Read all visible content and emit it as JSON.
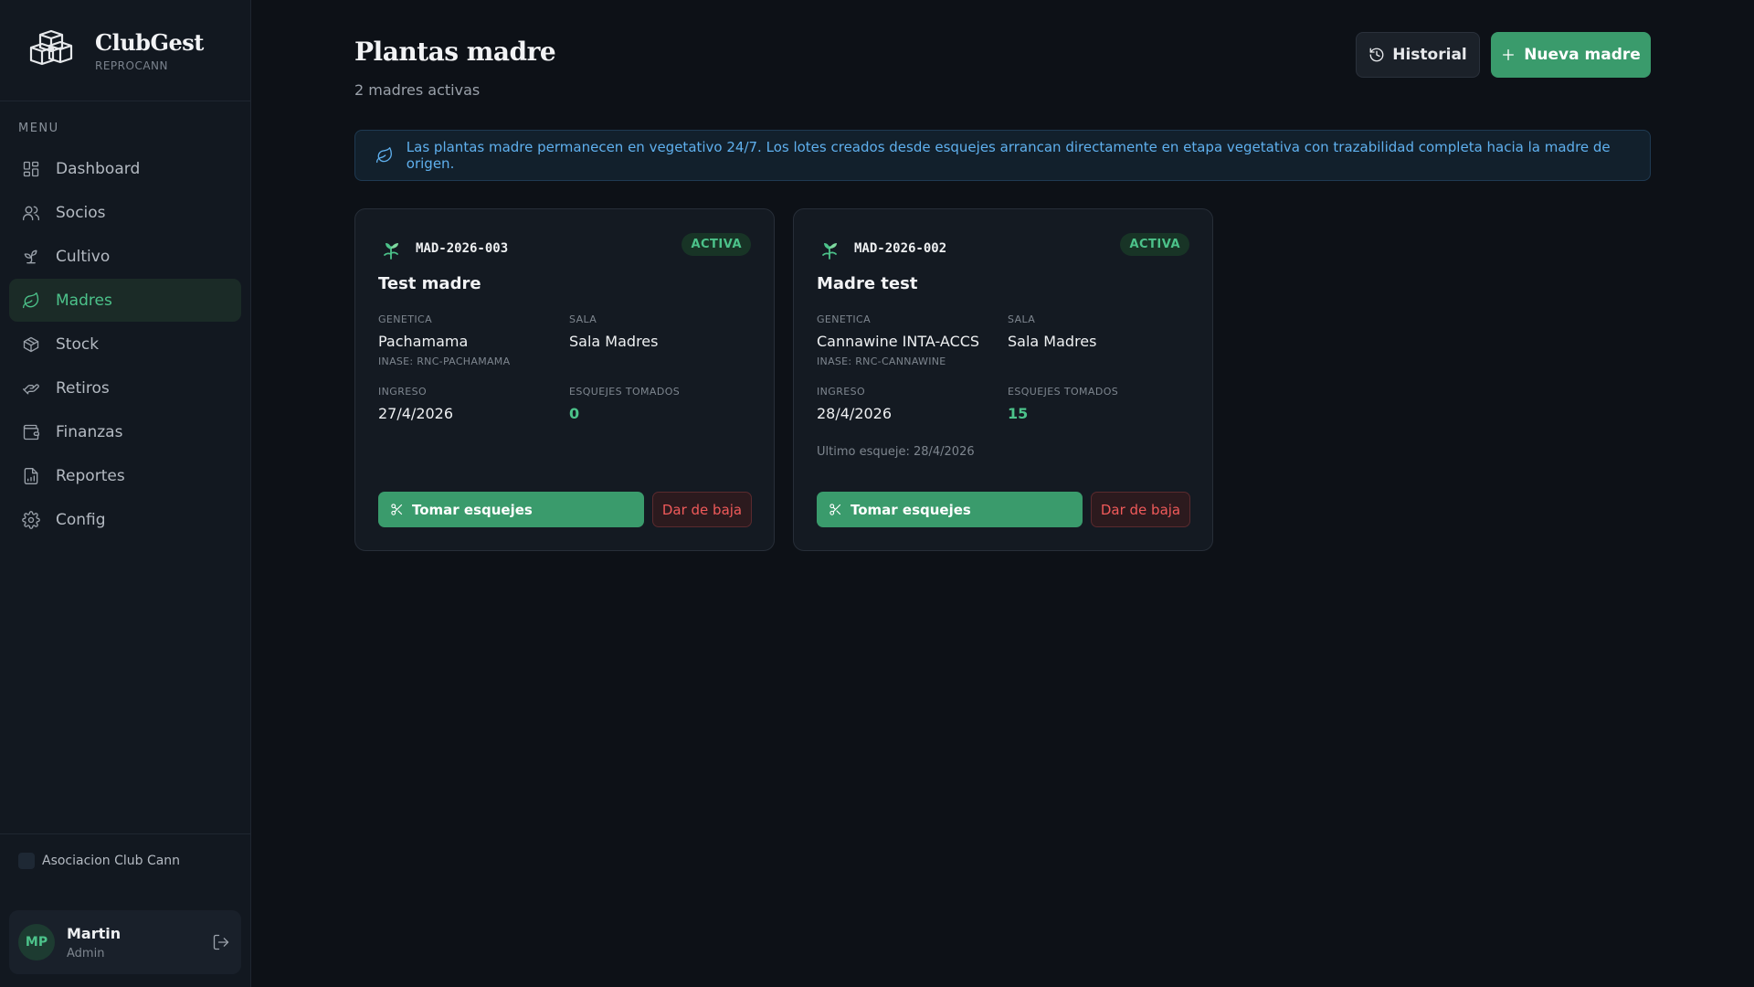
{
  "app": {
    "name": "ClubGest",
    "subtitle": "REPROCANN"
  },
  "sidebar": {
    "menu_label": "MENU",
    "items": [
      {
        "label": "Dashboard",
        "icon": "grid-icon",
        "active": false
      },
      {
        "label": "Socios",
        "icon": "users-icon",
        "active": false
      },
      {
        "label": "Cultivo",
        "icon": "sprout-icon",
        "active": false
      },
      {
        "label": "Madres",
        "icon": "leaf-icon",
        "active": true
      },
      {
        "label": "Stock",
        "icon": "package-icon",
        "active": false
      },
      {
        "label": "Retiros",
        "icon": "hand-icon",
        "active": false
      },
      {
        "label": "Finanzas",
        "icon": "wallet-icon",
        "active": false
      },
      {
        "label": "Reportes",
        "icon": "report-icon",
        "active": false
      },
      {
        "label": "Config",
        "icon": "gear-icon",
        "active": false
      }
    ],
    "organization": "Asociacion Club Cann",
    "user": {
      "initials": "MP",
      "name": "Martin",
      "role": "Admin"
    }
  },
  "header": {
    "title": "Plantas madre",
    "subtitle": "2 madres activas",
    "history_label": "Historial",
    "new_label": "Nueva madre"
  },
  "info_banner": "Las plantas madre permanecen en vegetativo 24/7. Los lotes creados desde esquejes arrancan directamente en etapa vegetativa con trazabilidad completa hacia la madre de origen.",
  "labels": {
    "genetics": "GENETICA",
    "room": "SALA",
    "entry": "INGRESO",
    "cuttings": "ESQUEJES TOMADOS",
    "take_cuttings": "Tomar esquejes",
    "deactivate": "Dar de baja"
  },
  "colors": {
    "accent": "#3a9b6c",
    "accent_text": "#4cc28a",
    "danger": "#f05a5a",
    "info": "#5fb0ee",
    "background": "#0d1117"
  },
  "mothers": [
    {
      "code": "MAD-2026-003",
      "status": "ACTIVA",
      "name": "Test madre",
      "genetics": "Pachamama",
      "inase": "INASE: RNC-PACHAMAMA",
      "room": "Sala Madres",
      "entry_date": "27/4/2026",
      "cuttings_taken": "0",
      "last_cutting": ""
    },
    {
      "code": "MAD-2026-002",
      "status": "ACTIVA",
      "name": "Madre test",
      "genetics": "Cannawine INTA-ACCS",
      "inase": "INASE: RNC-CANNAWINE",
      "room": "Sala Madres",
      "entry_date": "28/4/2026",
      "cuttings_taken": "15",
      "last_cutting": "Ultimo esqueje: 28/4/2026"
    }
  ]
}
